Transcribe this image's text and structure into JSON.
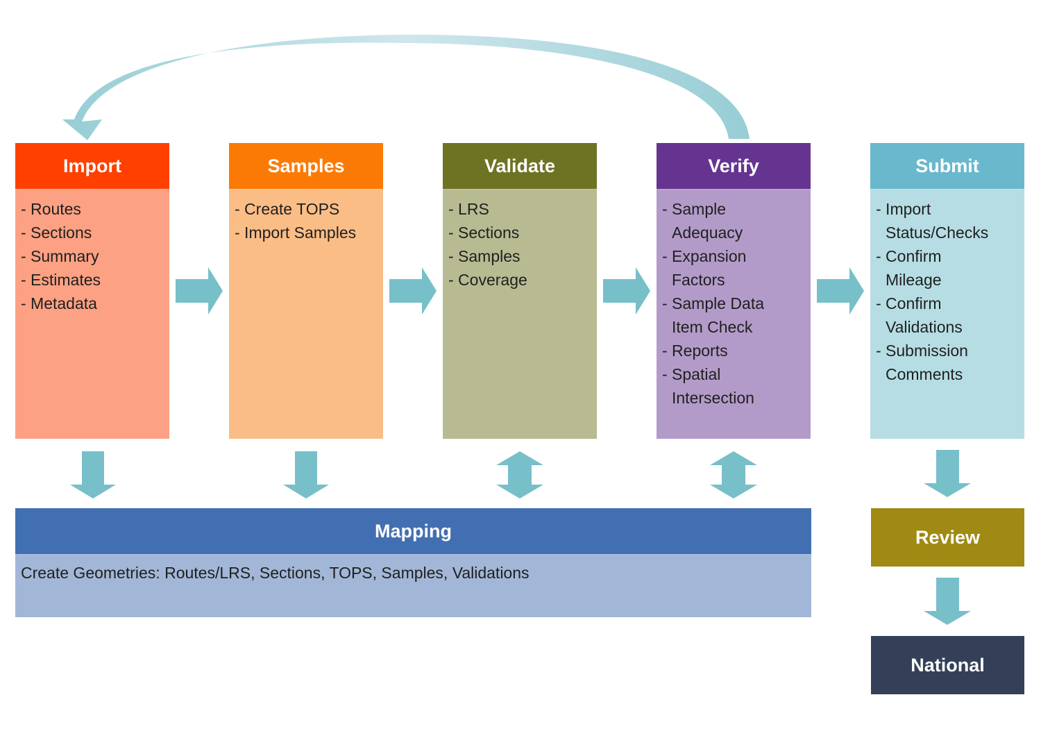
{
  "colors": {
    "arrow": "#77bfc9",
    "loop_arrow_light": "#cfe7ec",
    "loop_arrow_dark": "#97cdd5"
  },
  "stages": [
    {
      "title": "Import",
      "header_color": "#ff4000",
      "body_color": "#fca183",
      "items": [
        [
          "- Routes"
        ],
        [
          "- Sections"
        ],
        [
          "- Summary"
        ],
        [
          "- Estimates"
        ],
        [
          "- Metadata"
        ]
      ]
    },
    {
      "title": "Samples",
      "header_color": "#fb7a05",
      "body_color": "#fbbd86",
      "items": [
        [
          "- Create TOPS"
        ],
        [
          "- Import Samples"
        ]
      ]
    },
    {
      "title": "Validate",
      "header_color": "#6d7323",
      "body_color": "#b8bb92",
      "items": [
        [
          "- LRS"
        ],
        [
          "- Sections"
        ],
        [
          "- Samples"
        ],
        [
          "- Coverage"
        ]
      ]
    },
    {
      "title": "Verify",
      "header_color": "#653490",
      "body_color": "#b39bc9",
      "items": [
        [
          "- Sample",
          "Adequacy"
        ],
        [
          "- Expansion",
          "Factors"
        ],
        [
          "- Sample Data",
          "Item Check"
        ],
        [
          "- Reports"
        ],
        [
          "- Spatial",
          "Intersection"
        ]
      ]
    },
    {
      "title": "Submit",
      "header_color": "#6ab8cc",
      "body_color": "#b6dde4",
      "items": [
        [
          "- Import",
          "Status/Checks"
        ],
        [
          "- Confirm",
          "Mileage"
        ],
        [
          "- Confirm",
          "Validations"
        ],
        [
          "- Submission",
          "Comments"
        ]
      ]
    }
  ],
  "mapping": {
    "title": "Mapping",
    "description": "Create Geometries: Routes/LRS, Sections, TOPS, Samples, Validations",
    "header_color": "#426fb2",
    "body_color": "#a2b7d7"
  },
  "review": {
    "title": "Review",
    "color": "#a08a14"
  },
  "national": {
    "title": "National",
    "color": "#334058"
  },
  "connectors": {
    "horizontal": [
      "Import→Samples",
      "Samples→Validate",
      "Validate→Verify",
      "Verify→Submit"
    ],
    "to_mapping": [
      {
        "from": "Import",
        "type": "down"
      },
      {
        "from": "Samples",
        "type": "down"
      },
      {
        "from": "Validate",
        "type": "bidirectional"
      },
      {
        "from": "Verify",
        "type": "bidirectional"
      }
    ],
    "loop": {
      "from": "Verify",
      "to": "Import"
    },
    "submit_chain": [
      "Submit→Review",
      "Review→National"
    ]
  }
}
